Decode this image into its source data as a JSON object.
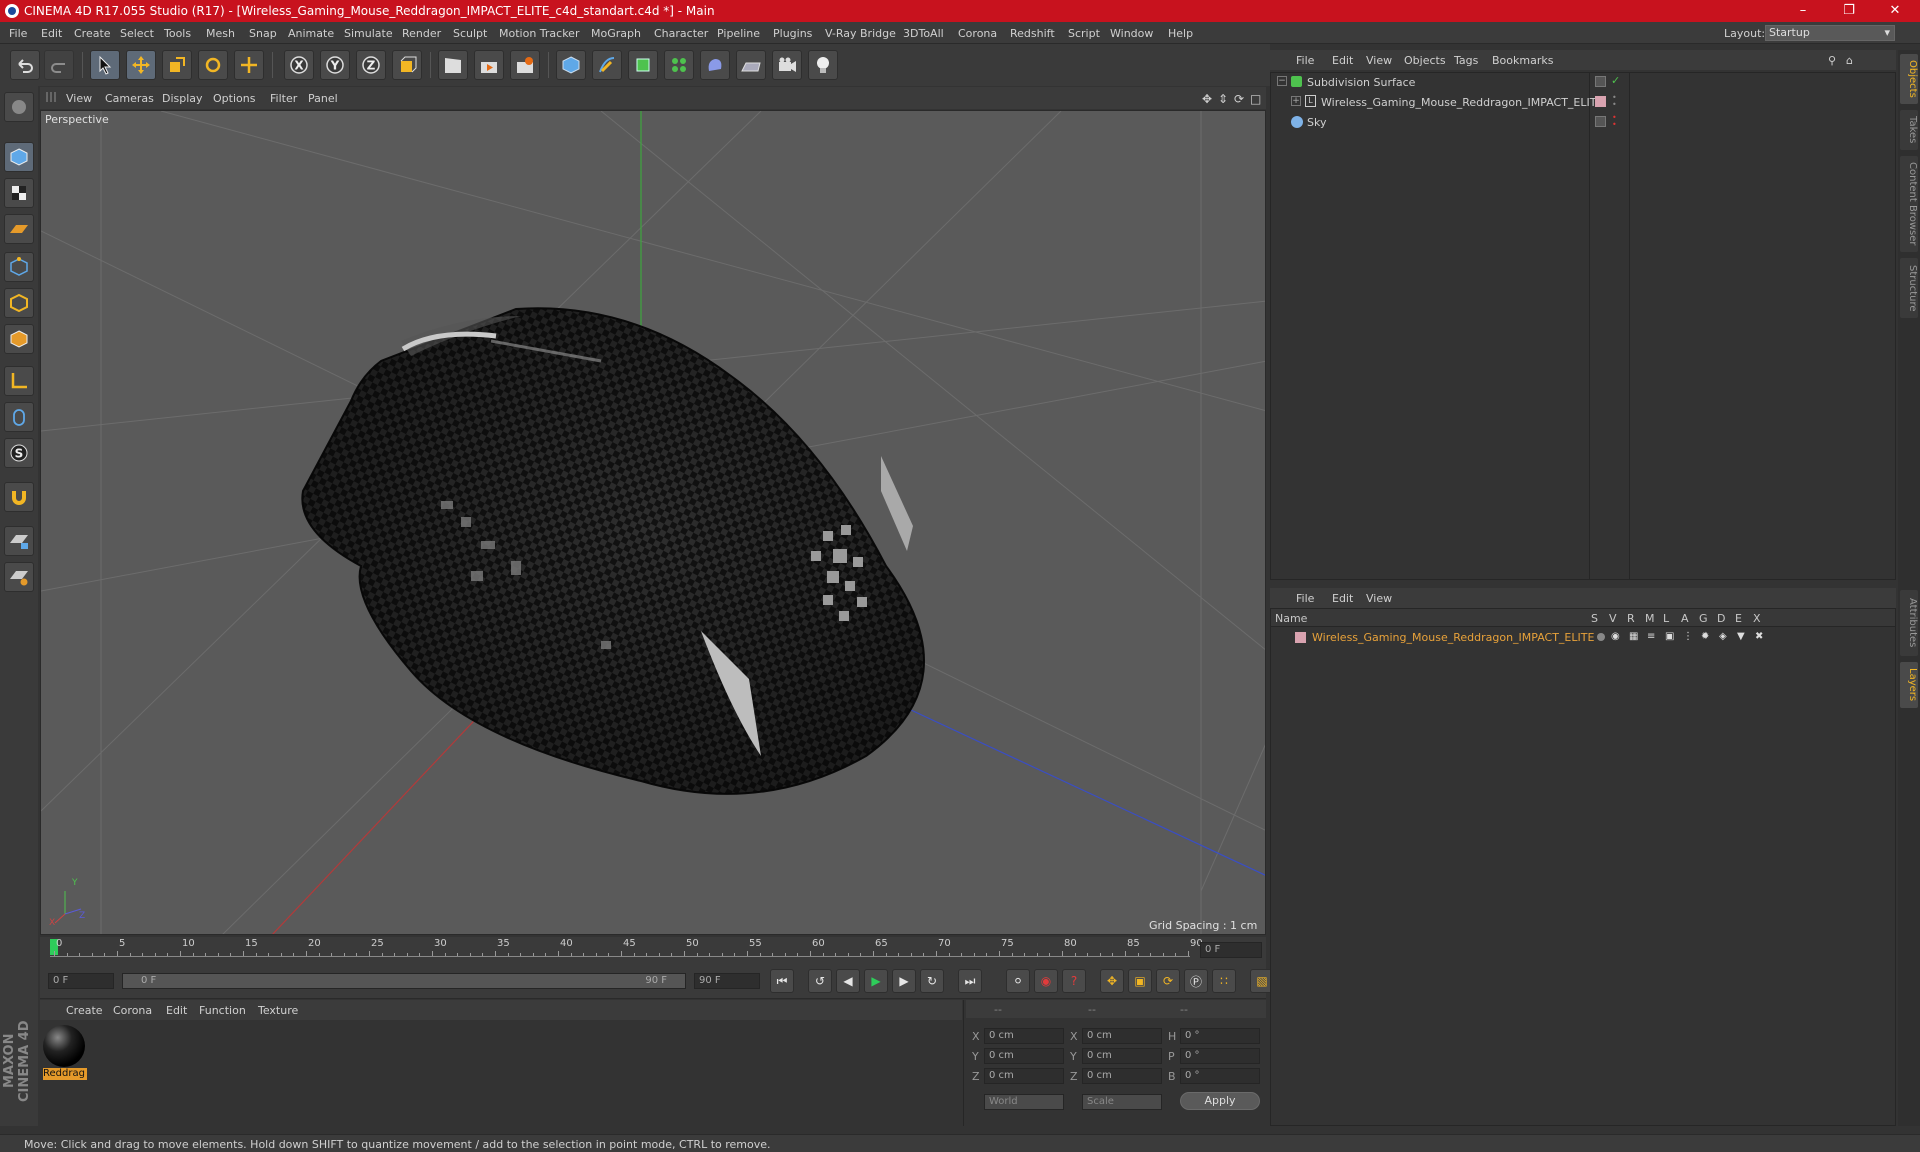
{
  "window": {
    "title": "CINEMA 4D R17.055 Studio (R17) - [Wireless_Gaming_Mouse_Reddragon_IMPACT_ELITE_c4d_standart.c4d *] - Main",
    "accent": "#c8121e"
  },
  "menu": [
    "File",
    "Edit",
    "Create",
    "Select",
    "Tools",
    "Mesh",
    "Snap",
    "Animate",
    "Simulate",
    "Render",
    "Sculpt",
    "Motion Tracker",
    "MoGraph",
    "Character",
    "Pipeline",
    "Plugins",
    "V-Ray Bridge",
    "3DToAll",
    "Corona",
    "Redshift",
    "Script",
    "Window",
    "Help"
  ],
  "layout": {
    "label": "Layout:",
    "value": "Startup"
  },
  "viewport": {
    "menu": [
      "View",
      "Cameras",
      "Display",
      "Options",
      "Filter",
      "Panel"
    ],
    "camera_label": "Perspective",
    "grid_spacing": "Grid Spacing : 1 cm"
  },
  "timeline": {
    "ticks": [
      "0",
      "5",
      "10",
      "15",
      "20",
      "25",
      "30",
      "35",
      "40",
      "45",
      "50",
      "55",
      "60",
      "65",
      "70",
      "75",
      "80",
      "85",
      "90"
    ],
    "current_frame": "0 F",
    "start": "0 F",
    "range_start": "0 F",
    "range_end": "90 F",
    "end": "90 F"
  },
  "materials": {
    "menu": [
      "Create",
      "Corona",
      "Edit",
      "Function",
      "Texture"
    ],
    "items": [
      {
        "label": "Reddrag"
      }
    ]
  },
  "coordinates": {
    "header": [
      "--",
      "--",
      "--"
    ],
    "rows": [
      {
        "axis": "X",
        "pos": "0 cm",
        "axis2": "X",
        "size": "0 cm",
        "axis3": "H",
        "rot": "0 °"
      },
      {
        "axis": "Y",
        "pos": "0 cm",
        "axis2": "Y",
        "size": "0 cm",
        "axis3": "P",
        "rot": "0 °"
      },
      {
        "axis": "Z",
        "pos": "0 cm",
        "axis2": "Z",
        "size": "0 cm",
        "axis3": "B",
        "rot": "0 °"
      }
    ],
    "mode1": "World",
    "mode2": "Scale",
    "apply": "Apply"
  },
  "object_manager": {
    "menu": [
      "File",
      "Edit",
      "View",
      "Objects",
      "Tags",
      "Bookmarks"
    ],
    "objects": [
      {
        "name": "Subdivision Surface"
      },
      {
        "name": "Wireless_Gaming_Mouse_Reddragon_IMPACT_ELITE"
      },
      {
        "name": "Sky"
      }
    ]
  },
  "layer_manager": {
    "menu": [
      "File",
      "Edit",
      "View"
    ],
    "columns": [
      "Name",
      "S",
      "V",
      "R",
      "M",
      "L",
      "A",
      "G",
      "D",
      "E",
      "X"
    ],
    "layers": [
      {
        "name": "Wireless_Gaming_Mouse_Reddragon_IMPACT_ELITE",
        "color": "#e8a23a"
      }
    ]
  },
  "right_tabs": [
    "Objects",
    "Takes",
    "Content Browser",
    "Structure",
    "Attributes",
    "Layers"
  ],
  "brand": "MAXON CINEMA 4D",
  "status": "Move: Click and drag to move elements. Hold down SHIFT to quantize movement / add to the selection in point mode, CTRL to remove."
}
